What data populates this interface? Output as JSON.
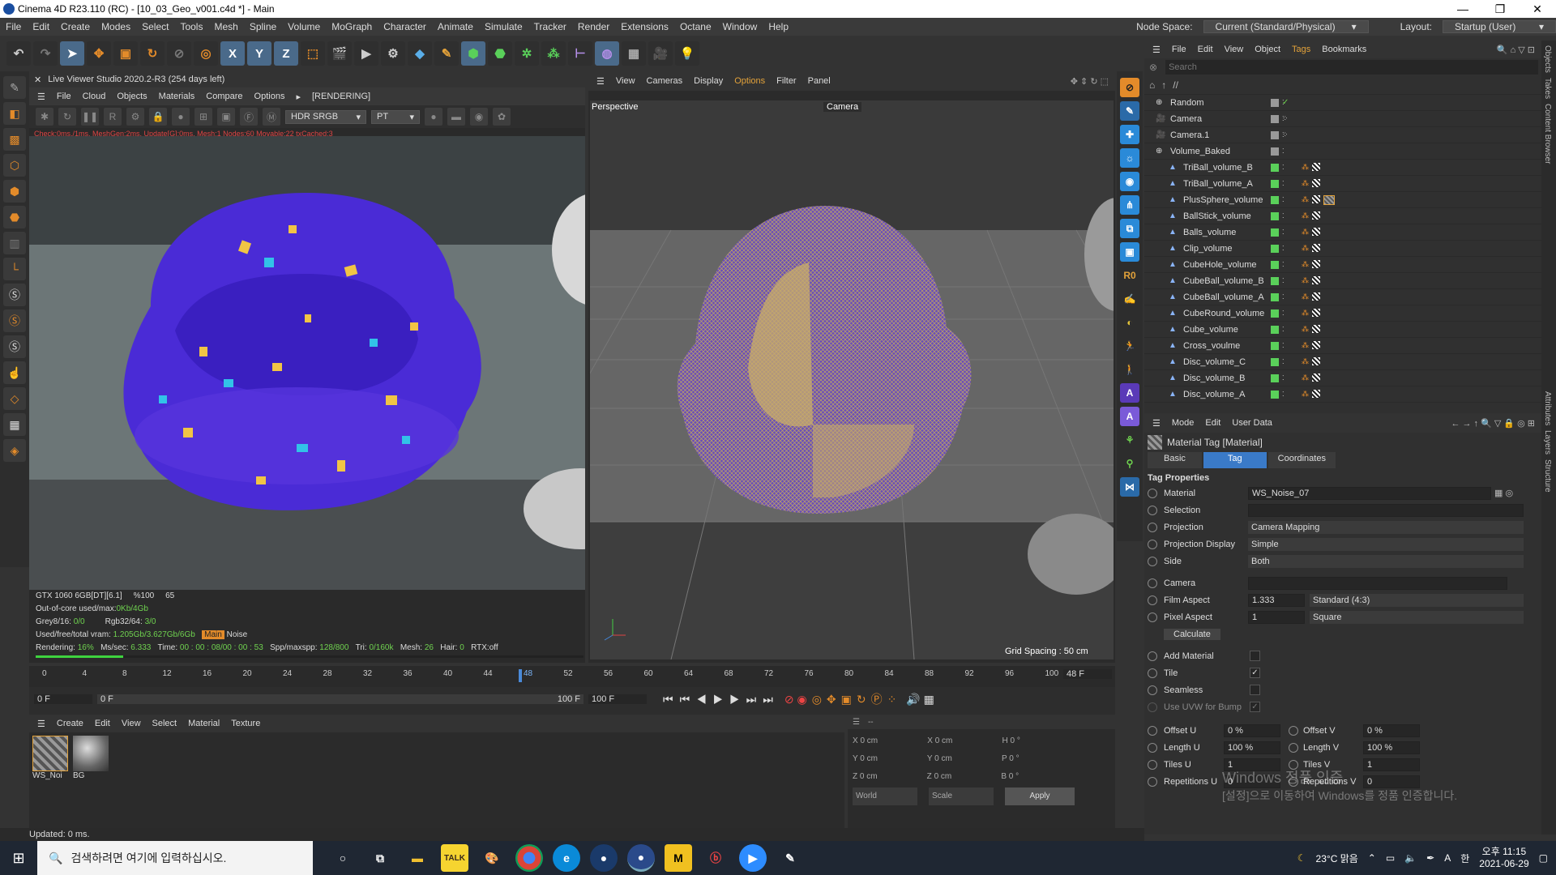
{
  "window": {
    "title": "Cinema 4D R23.110 (RC) - [10_03_Geo_v001.c4d *] - Main",
    "ctrl": [
      "—",
      "❐",
      "✕"
    ]
  },
  "menu": {
    "items": [
      "File",
      "Edit",
      "Create",
      "Modes",
      "Select",
      "Tools",
      "Mesh",
      "Spline",
      "Volume",
      "MoGraph",
      "Character",
      "Animate",
      "Simulate",
      "Tracker",
      "Render",
      "Extensions",
      "Octane",
      "Window",
      "Help"
    ],
    "node_space_label": "Node Space:",
    "node_space_value": "Current (Standard/Physical)",
    "layout_label": "Layout:",
    "layout_value": "Startup (User)"
  },
  "live_viewer": {
    "title": "Live Viewer Studio 2020.2-R3 (254 days left)",
    "menu": [
      "File",
      "Cloud",
      "Objects",
      "Materials",
      "Compare",
      "Options",
      "[RENDERING]"
    ],
    "color_mode": "HDR SRGB",
    "pt": "PT",
    "status": "Check:0ms./1ms. MeshGen:2ms. Update[G]:0ms. Mesh:1 Nodes:60 Movable:22 txCached:3",
    "gpu": {
      "l1": "GTX 1060 6GB[DT][6.1]",
      "l1b": "%100",
      "l1c": "65",
      "l2": "Out-of-core used/max:",
      "l2v": "0Kb/4Gb",
      "l3": "Grey8/16:",
      "l3v": "0/0",
      "l3b": "Rgb32/64:",
      "l3bv": "3/0",
      "l4": "Used/free/total vram:",
      "l4v": "1.205Gb/3.627Gb/6Gb",
      "l4b": "Main",
      "l4c": "Noise",
      "render": "Rendering:",
      "render_pct": "16%",
      "ms": "Ms/sec:",
      "ms_v": "6.333",
      "time": "Time:",
      "time_v": "00 : 00 : 08/00 : 00 : 53",
      "spp": "Spp/maxspp:",
      "spp_v": "128/800",
      "tri": "Tri:",
      "tri_v": "0/160k",
      "mesh": "Mesh:",
      "mesh_v": "26",
      "hair": "Hair:",
      "hair_v": "0",
      "rtx": "RTX:off"
    },
    "progress": 0.16
  },
  "viewport": {
    "menu": [
      "View",
      "Cameras",
      "Display",
      "Options",
      "Filter",
      "Panel"
    ],
    "label": "Perspective",
    "camera": "Camera",
    "grid": "Grid Spacing : 50 cm"
  },
  "objects": {
    "menu": [
      "File",
      "Edit",
      "View",
      "Object",
      "Tags",
      "Bookmarks"
    ],
    "search_placeholder": "Search",
    "path": "//",
    "rows": [
      {
        "name": "Random",
        "kind": "null"
      },
      {
        "name": "Camera",
        "kind": "cam"
      },
      {
        "name": "Camera.1",
        "kind": "cam"
      },
      {
        "name": "Volume_Baked",
        "kind": "null"
      },
      {
        "name": "TriBall_volume_B",
        "kind": "child"
      },
      {
        "name": "TriBall_volume_A",
        "kind": "child"
      },
      {
        "name": "PlusSphere_volume",
        "kind": "child"
      },
      {
        "name": "BallStick_volume",
        "kind": "child"
      },
      {
        "name": "Balls_volume",
        "kind": "child"
      },
      {
        "name": "Clip_volume",
        "kind": "child"
      },
      {
        "name": "CubeHole_volume",
        "kind": "child"
      },
      {
        "name": "CubeBall_volume_B",
        "kind": "child"
      },
      {
        "name": "CubeBall_volume_A",
        "kind": "child"
      },
      {
        "name": "CubeRound_volume",
        "kind": "child"
      },
      {
        "name": "Cube_volume",
        "kind": "child"
      },
      {
        "name": "Cross_voulme",
        "kind": "child"
      },
      {
        "name": "Disc_volume_C",
        "kind": "child"
      },
      {
        "name": "Disc_volume_B",
        "kind": "child"
      },
      {
        "name": "Disc_volume_A",
        "kind": "child"
      }
    ]
  },
  "attributes": {
    "menu": [
      "Mode",
      "Edit",
      "User Data"
    ],
    "header": "Material Tag [Material]",
    "tabs": [
      "Basic",
      "Tag",
      "Coordinates"
    ],
    "section": "Tag Properties",
    "material_label": "Material",
    "material": "WS_Noise_07",
    "selection_label": "Selection",
    "projection_label": "Projection",
    "projection": "Camera Mapping",
    "projdisp_label": "Projection Display",
    "projdisp": "Simple",
    "side_label": "Side",
    "side": "Both",
    "camera_label": "Camera",
    "film_label": "Film Aspect",
    "film": "1.333",
    "film_std": "Standard (4:3)",
    "pixel_label": "Pixel Aspect",
    "pixel": "1",
    "pixel_std": "Square",
    "calculate": "Calculate",
    "addmat_label": "Add Material",
    "tile_label": "Tile",
    "seamless_label": "Seamless",
    "uvw_label": "Use UVW for Bump",
    "offu_label": "Offset U",
    "offu": "0 %",
    "offv_label": "Offset V",
    "offv": "0 %",
    "lenu_label": "Length U",
    "lenu": "100 %",
    "lenv_label": "Length V",
    "lenv": "100 %",
    "tilesu_label": "Tiles U",
    "tilesu": "1",
    "tilesv_label": "Tiles V",
    "tilesv": "1",
    "repu_label": "Repetitions U",
    "repu": "0",
    "repv_label": "Repetitions V",
    "repv": "0"
  },
  "watermark": {
    "l1": "Windows 정품 인증",
    "l2": "[설정]으로 이동하여 Windows를 정품 인증합니다."
  },
  "timeline": {
    "ticks": [
      "0",
      "4",
      "8",
      "12",
      "16",
      "20",
      "24",
      "28",
      "32",
      "36",
      "40",
      "44",
      "48",
      "52",
      "56",
      "60",
      "64",
      "68",
      "72",
      "76",
      "80",
      "84",
      "88",
      "92",
      "96",
      "100"
    ],
    "current": "48 F",
    "start": "0 F",
    "start2": "0 F",
    "end": "100 F",
    "end2": "100 F"
  },
  "materials": {
    "menu": [
      "Create",
      "Edit",
      "View",
      "Select",
      "Material",
      "Texture"
    ],
    "items": [
      "WS_Noi",
      "BG"
    ]
  },
  "coords": {
    "x": "X",
    "y": "Y",
    "z": "Z",
    "x2": "X",
    "y2": "Y",
    "z2": "Z",
    "h": "H",
    "p": "P",
    "b": "B",
    "cm": "0 cm",
    "deg": "0 °",
    "world": "World",
    "scale": "Scale",
    "apply": "Apply",
    "dash": "--"
  },
  "status": "Updated: 0 ms.",
  "taskbar": {
    "search": "검색하려면 여기에 입력하십시오.",
    "weather": "23°C 맑음",
    "time": "오후 11:15",
    "date": "2021-06-29",
    "ime": "A",
    "lang": "한"
  }
}
